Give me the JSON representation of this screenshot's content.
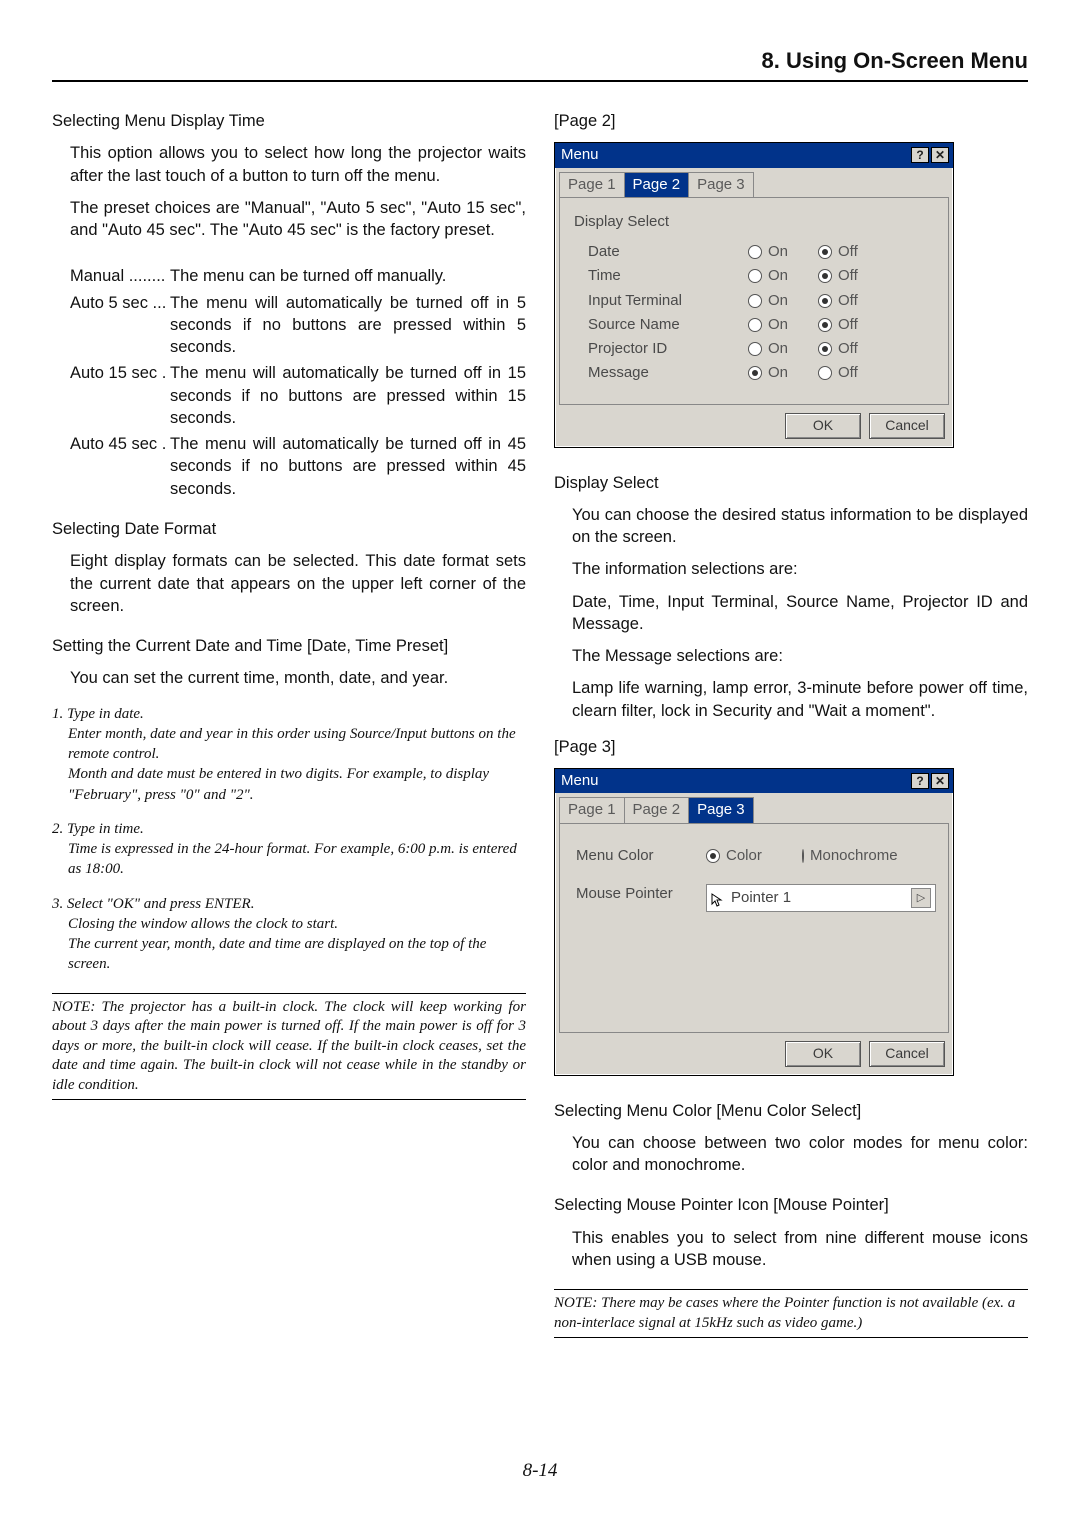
{
  "header": {
    "title": "8. Using On-Screen Menu"
  },
  "left": {
    "h_displayTime": "Selecting Menu Display Time",
    "p_displayTime": "This option allows you to select how long the projector waits after the last touch of a button to turn off the menu.",
    "p_presets": "The preset choices are \"Manual\", \"Auto 5 sec\", \"Auto 15 sec\", and \"Auto 45 sec\". The \"Auto 45 sec\" is the factory preset.",
    "defs": [
      {
        "term": "Manual ........",
        "desc": "The menu can be turned off manually."
      },
      {
        "term": "Auto 5 sec ...",
        "desc": "The menu will automatically be turned off in 5 seconds if no buttons are pressed within 5 seconds."
      },
      {
        "term": "Auto 15 sec .",
        "desc": "The menu will automatically be turned off in 15 seconds if no buttons are pressed within 15 seconds."
      },
      {
        "term": "Auto 45 sec .",
        "desc": "The menu will automatically be turned off in 45 seconds if no buttons are pressed within 45 seconds."
      }
    ],
    "h_dateFormat": "Selecting Date Format",
    "p_dateFormat": "Eight display formats can be selected. This date format sets the current date that appears on the upper left corner of the screen.",
    "h_dateTime": "Setting the Current Date and Time [Date, Time Preset]",
    "p_dateTime": "You can set the current time, month, date, and year.",
    "steps": [
      {
        "num": "1. Type in date.",
        "lines": [
          "Enter month, date and year in this order using Source/Input buttons on the remote control.",
          "Month and date must be entered in two digits. For example, to display \"February\", press \"0\" and \"2\"."
        ]
      },
      {
        "num": "2. Type in time.",
        "lines": [
          "Time is expressed in the 24-hour format. For example, 6:00 p.m. is entered as 18:00."
        ]
      },
      {
        "num": "3. Select \"OK\" and press ENTER.",
        "lines": [
          "Closing the window allows the clock to start.",
          "The current year, month, date and time are displayed on the top of the screen."
        ]
      }
    ],
    "note": "NOTE: The projector has a built-in clock. The clock will keep working for about 3 days after the main power is turned off. If the main power is off for 3 days or more, the built-in clock will cease. If the built-in clock ceases, set the date and time again. The built-in clock will not cease while in the standby or idle condition."
  },
  "right": {
    "page2Caption": "[Page 2]",
    "page3Caption": "[Page 3]",
    "dialog": {
      "title": "Menu",
      "help": "?",
      "close": "✕",
      "tabs": [
        "Page 1",
        "Page 2",
        "Page 3"
      ],
      "displaySelectLabel": "Display Select",
      "onLabel": "On",
      "offLabel": "Off",
      "rows": [
        {
          "name": "Date",
          "value": "off"
        },
        {
          "name": "Time",
          "value": "off"
        },
        {
          "name": "Input Terminal",
          "value": "off"
        },
        {
          "name": "Source Name",
          "value": "off"
        },
        {
          "name": "Projector ID",
          "value": "off"
        },
        {
          "name": "Message",
          "value": "on"
        }
      ],
      "ok": "OK",
      "cancel": "Cancel",
      "page3": {
        "menuColorLabel": "Menu Color",
        "colorOption": "Color",
        "monoOption": "Monochrome",
        "menuColorValue": "color",
        "mousePointerLabel": "Mouse Pointer",
        "mousePointerValue": "Pointer 1",
        "arrow": "▷"
      }
    },
    "afterPage2": {
      "h": "Display Select",
      "p1": "You can choose the desired status information to be displayed on the screen.",
      "p2": "The information selections are:",
      "p3": "Date, Time, Input Terminal, Source Name, Projector ID and Message.",
      "p4": "The Message selections are:",
      "p5": "Lamp life warning, lamp error, 3-minute before power off time, clearn filter, lock in Security and \"Wait a moment\"."
    },
    "afterPage3": {
      "h1": "Selecting Menu Color [Menu Color Select]",
      "p1": "You can choose between two color modes for menu color: color and monochrome.",
      "h2": "Selecting Mouse Pointer Icon [Mouse Pointer]",
      "p2": "This enables you to select from nine different mouse icons when using a USB mouse.",
      "note": "NOTE: There may be cases where the Pointer function is not available (ex. a non-interlace signal at 15kHz such as video game.)"
    }
  },
  "pageNumber": "8-14"
}
